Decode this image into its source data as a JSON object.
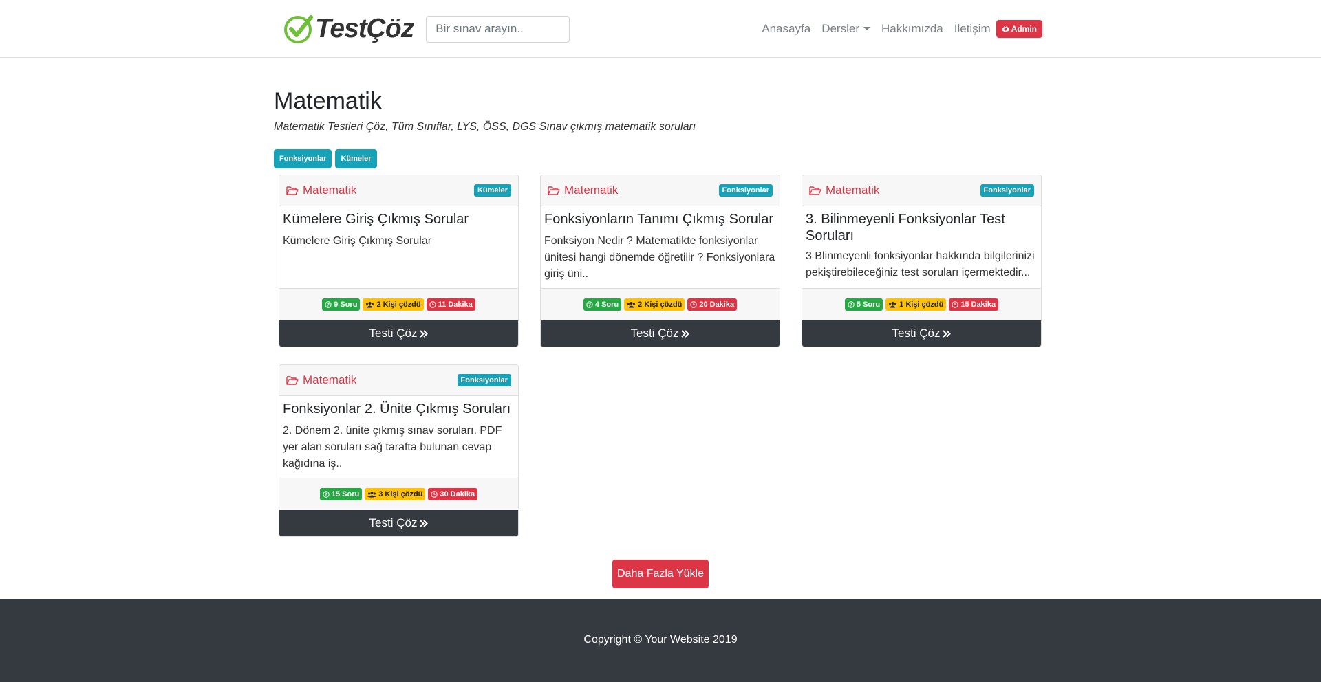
{
  "brand": {
    "name": "TestÇöz",
    "accent": "#6fbf3a"
  },
  "search": {
    "placeholder": "Bir sınav arayın.."
  },
  "nav": {
    "home": "Anasayfa",
    "lessons": "Dersler",
    "about": "Hakkımızda",
    "contact": "İletişim",
    "admin": "Admin"
  },
  "page": {
    "title": "Matematik",
    "description": "Matematik Testleri Çöz, Tüm Sınıflar, LYS, ÖSS, DGS Sınav çıkmış matematik soruları",
    "tags": [
      "Fonksiyonlar",
      "Kümeler"
    ]
  },
  "cards": [
    {
      "category": "Matematik",
      "badge": "Kümeler",
      "title": "Kümelere Giriş Çıkmış Sorular",
      "text": "Kümelere Giriş Çıkmış Sorular",
      "questions": "9 Soru",
      "solved": "2 Kişi çözdü",
      "duration": "11 Dakika",
      "button": "Testi Çöz"
    },
    {
      "category": "Matematik",
      "badge": "Fonksiyonlar",
      "title": "Fonksiyonların Tanımı Çıkmış Sorular",
      "text": "Fonksiyon Nedir ? Matematikte fonksiyonlar ünitesi hangi dönemde öğretilir ? Fonksiyonlara giriş üni..",
      "questions": "4 Soru",
      "solved": "2 Kişi çözdü",
      "duration": "20 Dakika",
      "button": "Testi Çöz"
    },
    {
      "category": "Matematik",
      "badge": "Fonksiyonlar",
      "title": "3. Bilinmeyenli Fonksiyonlar Test Soruları",
      "text": "3 Blinmeyenli fonksiyonlar hakkında bilgilerinizi pekiştirebileceğiniz test soruları içermektedir...",
      "questions": "5 Soru",
      "solved": "1 Kişi çözdü",
      "duration": "15 Dakika",
      "button": "Testi Çöz"
    },
    {
      "category": "Matematik",
      "badge": "Fonksiyonlar",
      "title": "Fonksiyonlar 2. Ünite Çıkmış Soruları",
      "text": "2. Dönem 2. ünite çıkmış sınav soruları. PDF yer alan soruları sağ tarafta bulunan cevap kağıdına iş..",
      "questions": "15 Soru",
      "solved": "3 Kişi çözdü",
      "duration": "30 Dakika",
      "button": "Testi Çöz"
    }
  ],
  "load_more": "Daha Fazla Yükle",
  "footer": {
    "copyright": "Copyright © Your Website 2019"
  }
}
